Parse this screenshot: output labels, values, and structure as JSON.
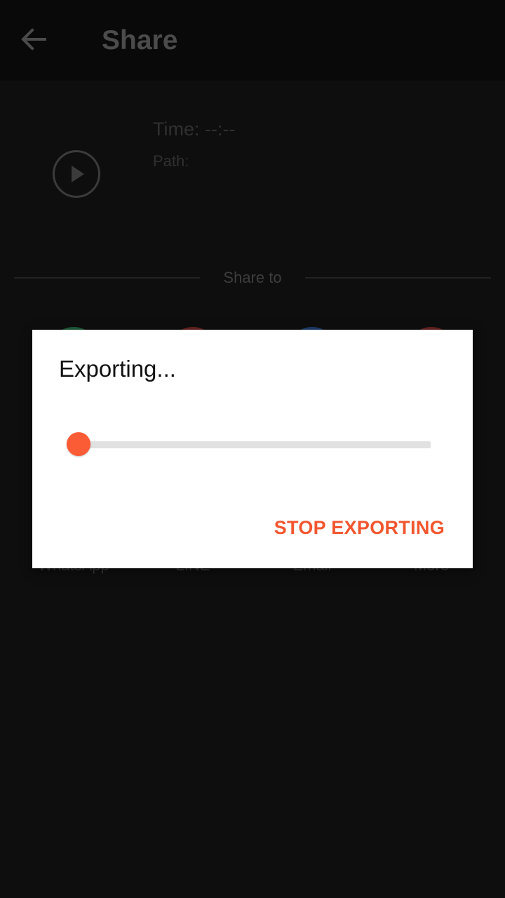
{
  "appbar": {
    "title": "Share",
    "back_icon": "arrow-left-icon"
  },
  "media": {
    "play_icon": "play-icon",
    "time": "Time: --:--",
    "path": "Path:"
  },
  "share": {
    "label": "Share to",
    "targets": [
      {
        "label": "WhatsApp",
        "color": "#1e5e3c"
      },
      {
        "label": "LINE",
        "color": "#6a2222"
      },
      {
        "label": "Email",
        "color": "#1d3e6e"
      },
      {
        "label": "More",
        "color": "#6a2222"
      }
    ]
  },
  "dialog": {
    "title": "Exporting...",
    "progress": 0,
    "stop_label": "STOP EXPORTING"
  },
  "colors": {
    "accent": "#fb5b35",
    "background": "#0e0e0e"
  }
}
